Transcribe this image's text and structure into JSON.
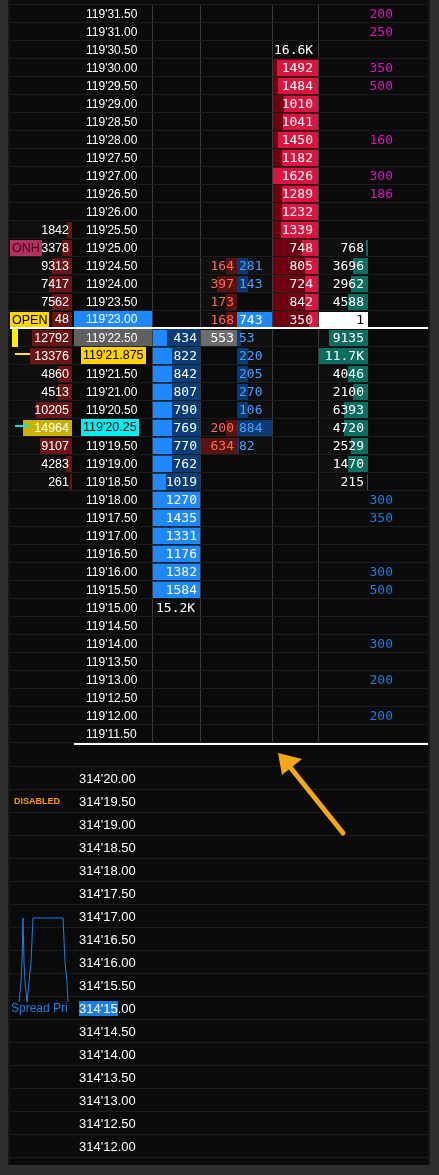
{
  "ladder": {
    "asks": [
      {
        "kind": "plain",
        "price": "119'31.50",
        "order": {
          "value": "200",
          "color": "#e010c8"
        }
      },
      {
        "kind": "plain",
        "price": "119'31.00",
        "order": {
          "value": "250",
          "color": "#e010c8"
        }
      },
      {
        "kind": "plain",
        "price": "119'30.50",
        "ask_total": "16.6K"
      },
      {
        "kind": "plain",
        "price": "119'30.00",
        "ask": {
          "value": "1492",
          "level": 0.92
        },
        "order": {
          "value": "350",
          "color": "#e010c8"
        }
      },
      {
        "kind": "plain",
        "price": "119'29.50",
        "ask": {
          "value": "1484",
          "level": 0.9
        },
        "order": {
          "value": "500",
          "color": "#e010c8"
        }
      },
      {
        "kind": "plain",
        "price": "119'29.00",
        "ask": {
          "value": "1010",
          "level": 0.76
        }
      },
      {
        "kind": "plain",
        "price": "119'28.50",
        "ask": {
          "value": "1041",
          "level": 0.78
        }
      },
      {
        "kind": "plain",
        "price": "119'28.00",
        "ask": {
          "value": "1450",
          "level": 0.88
        },
        "order": {
          "value": "160",
          "color": "#e010c8"
        }
      },
      {
        "kind": "plain",
        "price": "119'27.50",
        "ask": {
          "value": "1182",
          "level": 0.8
        }
      },
      {
        "kind": "plain",
        "price": "119'27.00",
        "ask": {
          "value": "1626",
          "level": 1
        },
        "order": {
          "value": "300",
          "color": "#e010c8"
        }
      },
      {
        "kind": "plain",
        "price": "119'26.50",
        "ask": {
          "value": "1289",
          "level": 0.8
        },
        "order": {
          "value": "186",
          "color": "#e010c8"
        }
      },
      {
        "kind": "plain",
        "price": "119'26.00",
        "ask": {
          "value": "1232",
          "level": 0.8
        }
      },
      {
        "kind": "plain",
        "price": "119'25.50",
        "profile": {
          "value": "1842",
          "level": 0.08,
          "poc": false
        },
        "ask": {
          "value": "1339",
          "level": 0.82
        }
      },
      {
        "kind": "plain",
        "price": "119'25.00",
        "profile": {
          "value": "3378",
          "level": 0.17,
          "poc": false,
          "tag": {
            "label": "ONH",
            "kind": "onh"
          }
        },
        "ask": {
          "value": "748",
          "level": 0.35
        },
        "volume": {
          "value": "768",
          "level": 0.05,
          "kind": "bar"
        }
      },
      {
        "kind": "plain",
        "price": "119'24.50",
        "profile": {
          "value": "9313",
          "level": 0.33,
          "poc": false
        },
        "sell": {
          "value": "164",
          "level": 0.3,
          "kind": "bar"
        },
        "buy": {
          "value": "281",
          "level": 0.3,
          "kind": "bar"
        },
        "ask": {
          "value": "805",
          "level": 0.3
        },
        "volume": {
          "value": "3696",
          "level": 0.3,
          "kind": "bar"
        }
      },
      {
        "kind": "plain",
        "price": "119'24.00",
        "profile": {
          "value": "7417",
          "level": 0.38,
          "poc": false
        },
        "sell": {
          "value": "397",
          "level": 0.55,
          "kind": "bar"
        },
        "buy": {
          "value": "143",
          "level": 0.3,
          "kind": "bar"
        },
        "ask": {
          "value": "724",
          "level": 0.3
        },
        "volume": {
          "value": "2962",
          "level": 0.35,
          "kind": "bar"
        }
      },
      {
        "kind": "plain",
        "price": "119'23.50",
        "profile": {
          "value": "7562",
          "level": 0.33,
          "poc": false
        },
        "sell": {
          "value": "173",
          "level": 0.3,
          "kind": "bar"
        },
        "ask": {
          "value": "842",
          "level": 0.3
        },
        "volume": {
          "value": "4588",
          "level": 0.4,
          "kind": "bar"
        }
      },
      {
        "kind": "last",
        "price": "119'23.00",
        "profile": {
          "value": "48",
          "level": 0.33,
          "poc": false,
          "tag": {
            "label": "OPEN",
            "kind": "open"
          }
        },
        "sell": {
          "value": "168",
          "level": 0.3,
          "kind": "bar"
        },
        "buy": {
          "value": "743",
          "level": 1,
          "kind": "full"
        },
        "ask": {
          "value": "350",
          "level": 0.2
        },
        "volume": {
          "value": "1",
          "level": 1,
          "kind": "current"
        }
      }
    ],
    "bids": [
      {
        "kind": "inside",
        "price": "119'22.50",
        "marker": {
          "kind": "bar",
          "color": "#ffee00"
        },
        "profile": {
          "value": "12792",
          "level": 0.67,
          "poc": false
        },
        "bid": {
          "value": "434",
          "level": 0.3
        },
        "sell": {
          "value": "553",
          "level": 1,
          "kind": "grey"
        },
        "buy": {
          "value": "53",
          "level": 0.1,
          "kind": "bar"
        },
        "volume": {
          "value": "9135",
          "level": 0.8,
          "kind": "bar"
        }
      },
      {
        "kind": "label",
        "color": "#ffd400",
        "price": "119'21.875",
        "marker": {
          "kind": "dash",
          "color": "#ffee00"
        },
        "profile": {
          "value": "13376",
          "level": 0.7,
          "poc": false
        },
        "bid": {
          "value": "822",
          "level": 0.4
        },
        "buy": {
          "value": "220",
          "level": 0.3,
          "kind": "bar"
        },
        "volume": {
          "value": "11.7K",
          "level": 1,
          "kind": "bar"
        }
      },
      {
        "kind": "plain",
        "price": "119'21.50",
        "profile": {
          "value": "4860",
          "level": 0.23,
          "poc": false
        },
        "bid": {
          "value": "842",
          "level": 0.4
        },
        "buy": {
          "value": "205",
          "level": 0.3,
          "kind": "bar"
        },
        "volume": {
          "value": "4046",
          "level": 0.4,
          "kind": "bar"
        }
      },
      {
        "kind": "plain",
        "price": "119'21.00",
        "profile": {
          "value": "4513",
          "level": 0.23,
          "poc": false
        },
        "bid": {
          "value": "807",
          "level": 0.4
        },
        "buy": {
          "value": "270",
          "level": 0.3,
          "kind": "bar"
        },
        "volume": {
          "value": "2100",
          "level": 0.3,
          "kind": "bar"
        }
      },
      {
        "kind": "plain",
        "price": "119'20.50",
        "profile": {
          "value": "10205",
          "level": 0.6,
          "poc": false
        },
        "bid": {
          "value": "790",
          "level": 0.4
        },
        "buy": {
          "value": "106",
          "level": 0.3,
          "kind": "bar"
        },
        "volume": {
          "value": "6393",
          "level": 0.5,
          "kind": "bar"
        }
      },
      {
        "kind": "label",
        "color": "#00f0f0",
        "price": "119'20.25",
        "marker": {
          "kind": "dash",
          "color": "#00e8f0"
        },
        "profile": {
          "value": "14964",
          "level": 0.82,
          "poc": true
        },
        "bid": {
          "value": "769",
          "level": 0.4
        },
        "sell": {
          "value": "200",
          "level": 0.3,
          "kind": "bar"
        },
        "buy": {
          "value": "884",
          "level": 1,
          "kind": "bar"
        },
        "volume": {
          "value": "4720",
          "level": 0.5,
          "kind": "bar"
        }
      },
      {
        "kind": "plain",
        "price": "119'19.50",
        "profile": {
          "value": "9107",
          "level": 0.53,
          "poc": false
        },
        "bid": {
          "value": "770",
          "level": 0.4
        },
        "sell": {
          "value": "634",
          "level": 1,
          "kind": "bar"
        },
        "buy": {
          "value": "82",
          "level": 0.05,
          "kind": "bar"
        },
        "volume": {
          "value": "2529",
          "level": 0.35,
          "kind": "bar"
        }
      },
      {
        "kind": "plain",
        "price": "119'19.00",
        "profile": {
          "value": "4283",
          "level": 0.1,
          "poc": false
        },
        "bid": {
          "value": "762",
          "level": 0.4
        },
        "volume": {
          "value": "1470",
          "level": 0.4,
          "kind": "bar"
        }
      },
      {
        "kind": "plain",
        "price": "119'18.50",
        "profile": {
          "value": "261",
          "level": 0.03,
          "poc": false
        },
        "bid": {
          "value": "1019",
          "level": 0.28
        },
        "volume": {
          "value": "215",
          "level": 0.03,
          "kind": "bar"
        }
      },
      {
        "kind": "plain",
        "price": "119'18.00",
        "bid": {
          "value": "1270",
          "level": 1
        },
        "order": {
          "value": "300",
          "color": "#1a7fe0"
        }
      },
      {
        "kind": "plain",
        "price": "119'17.50",
        "bid": {
          "value": "1435",
          "level": 1
        },
        "order": {
          "value": "350",
          "color": "#1a7fe0"
        }
      },
      {
        "kind": "plain",
        "price": "119'17.00",
        "bid": {
          "value": "1331",
          "level": 1
        }
      },
      {
        "kind": "plain",
        "price": "119'16.50",
        "bid": {
          "value": "1176",
          "level": 1
        }
      },
      {
        "kind": "plain",
        "price": "119'16.00",
        "bid": {
          "value": "1382",
          "level": 1
        },
        "order": {
          "value": "300",
          "color": "#1a7fe0"
        }
      },
      {
        "kind": "plain",
        "price": "119'15.50",
        "bid": {
          "value": "1584",
          "level": 1
        },
        "order": {
          "value": "500",
          "color": "#1a7fe0"
        }
      },
      {
        "kind": "plain",
        "price": "119'15.00",
        "bid_total": "15.2K"
      },
      {
        "kind": "plain",
        "price": "119'14.50"
      },
      {
        "kind": "plain",
        "price": "119'14.00",
        "order": {
          "value": "300",
          "color": "#1a7fe0"
        }
      },
      {
        "kind": "plain",
        "price": "119'13.50"
      },
      {
        "kind": "plain",
        "price": "119'13.00",
        "order": {
          "value": "200",
          "color": "#1a7fe0"
        }
      },
      {
        "kind": "plain",
        "price": "119'12.50"
      },
      {
        "kind": "plain",
        "price": "119'12.00",
        "order": {
          "value": "200",
          "color": "#1a7fe0"
        }
      },
      {
        "kind": "plain",
        "price": "119'11.50"
      }
    ]
  },
  "spread_ladder": {
    "rows": [
      {
        "price": "314'20.00"
      },
      {
        "price": "314'19.50",
        "status": "DISABLED"
      },
      {
        "price": "314'19.00"
      },
      {
        "price": "314'18.50"
      },
      {
        "price": "314'18.00"
      },
      {
        "price": "314'17.50"
      },
      {
        "price": "314'17.00"
      },
      {
        "price": "314'16.50"
      },
      {
        "price": "314'16.00"
      },
      {
        "price": "314'15.50"
      },
      {
        "price_highlight": "314'15",
        "price": ".00",
        "label": "Spread Pri"
      },
      {
        "price": "314'14.50"
      },
      {
        "price": "314'14.00"
      },
      {
        "price": "314'13.50"
      },
      {
        "price": "314'13.00"
      },
      {
        "price": "314'12.50"
      },
      {
        "price": "314'12.00"
      }
    ]
  }
}
